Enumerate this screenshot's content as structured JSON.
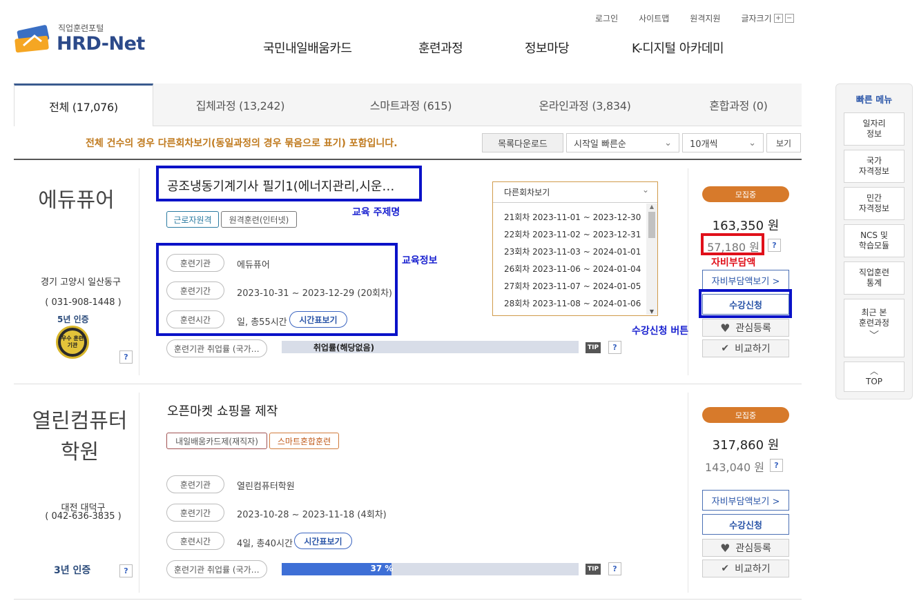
{
  "header": {
    "logo_top": "직업훈련포털",
    "logo_main": "HRD-Net",
    "util": [
      "로그인",
      "사이트맵",
      "원격지원",
      "글자크기"
    ],
    "gnb": [
      "국민내일배움카드",
      "훈련과정",
      "정보마당",
      "K-디지털 아카데미"
    ]
  },
  "tabs": [
    "전체 (17,076)",
    "집체과정 (13,242)",
    "스마트과정 (615)",
    "온라인과정 (3,834)",
    "혼합과정 (0)"
  ],
  "notice": "전체 건수의 경우 다른회차보기(동일과정의 경우 묶음으로 표기) 포함입니다.",
  "toolbar": {
    "download": "목록다운로드",
    "sort": "시작일 빠른순",
    "count": "10개씩",
    "view": "보기"
  },
  "quick_menu": {
    "title": "빠른 메뉴",
    "items": [
      "일자리\n정보",
      "국가\n자격정보",
      "민간\n자격정보",
      "NCS 및\n학습모듈",
      "직업훈련\n통계",
      "최근 본\n훈련과정"
    ],
    "top": "TOP"
  },
  "courses": [
    {
      "org": "에듀퓨어",
      "address": "경기 고양시 일산동구",
      "phone": "( 031-908-1448 )",
      "cert": "5년 인증",
      "badge": "우수 훈련기관",
      "title": "공조냉동기계기사 필기1(에너지관리,시운…",
      "tags": [
        "근로자원격",
        "원격훈련(인터넷)"
      ],
      "labels": [
        "훈련기관",
        "훈련기간",
        "훈련시간"
      ],
      "inst": "에듀퓨어",
      "period": "2023-10-31 ~ 2023-12-29 (20회차)",
      "hours": "일, 총55시간",
      "timetable": "시간표보기",
      "emp_label": "훈련기관 취업률 (국가…",
      "emp_text": "취업률(해당없음)",
      "emp_rate": 0,
      "status": "모집중",
      "price": "163,350 원",
      "self_price": "57,180 원",
      "self_btn": "자비부담액보기 >",
      "apply": "수강신청",
      "fav": "관심등록",
      "compare": "비교하기",
      "sessions_header": "다른회차보기",
      "sessions": [
        "21회차 2023-11-01 ~ 2023-12-30",
        "22회차 2023-11-02 ~ 2023-12-31",
        "23회차 2023-11-03 ~ 2024-01-01",
        "26회차 2023-11-06 ~ 2024-01-04",
        "27회차 2023-11-07 ~ 2024-01-05",
        "28회차 2023-11-08 ~ 2024-01-06"
      ]
    },
    {
      "org": "열린컴퓨터\n학원",
      "address": "대전 대덕구",
      "phone": "( 042-636-3835 )",
      "cert": "3년 인증",
      "title": "오픈마켓 쇼핑몰 제작",
      "tags": [
        "내일배움카드제(재직자)",
        "스마트혼합훈련"
      ],
      "labels": [
        "훈련기관",
        "훈련기간",
        "훈련시간"
      ],
      "inst": "열린컴퓨터학원",
      "period": "2023-10-28 ~ 2023-11-18 (4회차)",
      "hours": "4일, 총40시간",
      "timetable": "시간표보기",
      "emp_label": "훈련기관 취업률 (국가…",
      "emp_text": "37 %",
      "emp_rate": 0.37,
      "status": "모집중",
      "price": "317,860 원",
      "self_price": "143,040 원",
      "self_btn": "자비부담액보기 >",
      "apply": "수강신청",
      "fav": "관심등록",
      "compare": "비교하기"
    }
  ],
  "annotations": {
    "title": "교육 주제명",
    "info": "교육정보",
    "self": "자비부담액",
    "apply": "수강신청 버튼"
  },
  "tip": "TIP",
  "q": "?"
}
